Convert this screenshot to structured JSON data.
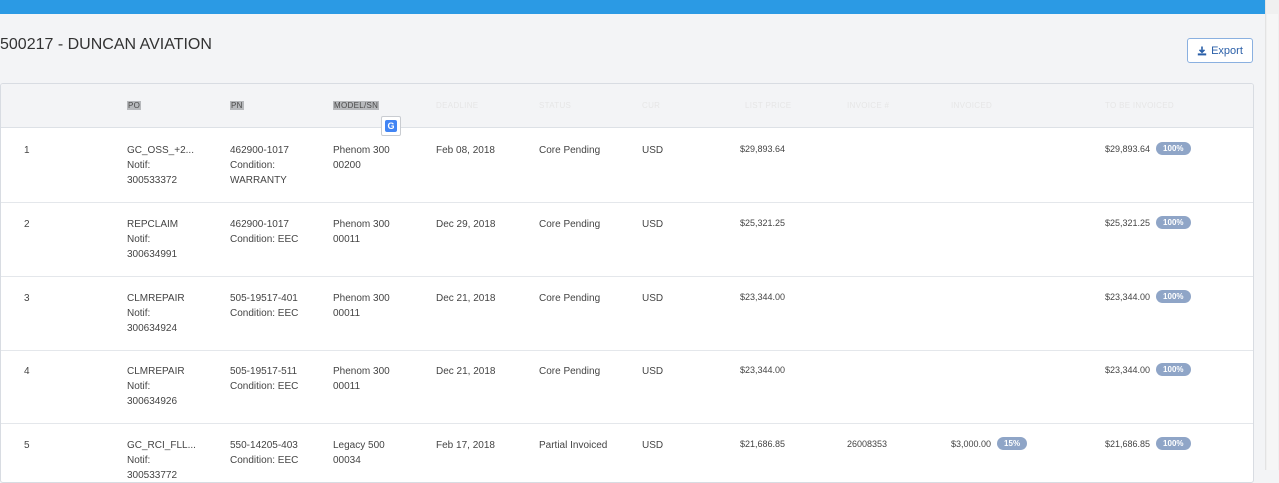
{
  "header": {
    "title": "500217 - DUNCAN AVIATION",
    "export_label": "Export"
  },
  "table": {
    "columns": [
      "PO",
      "PN",
      "MODEL/SN",
      "DEADLINE",
      "STATUS",
      "CUR",
      "LIST PRICE",
      "INVOICE #",
      "INVOICED",
      "TO BE INVOICED"
    ],
    "rows": [
      {
        "num": "1",
        "po": "GC_OSS_+2...",
        "notif_label": "Notif:",
        "notif": "300533372",
        "pn": "462900-1017",
        "condition_label": "Condition:",
        "condition": "WARRANTY",
        "model": "Phenom 300",
        "sn": "00200",
        "deadline": "Feb 08, 2018",
        "status": "Core Pending",
        "cur": "USD",
        "list_price": "$29,893.64",
        "invoice_no": "",
        "invoiced": "",
        "invoiced_pct": "",
        "to_be_invoiced": "$29,893.64",
        "to_be_pct": "100%"
      },
      {
        "num": "2",
        "po": "REPCLAIM",
        "notif_label": "Notif:",
        "notif": "300634991",
        "pn": "462900-1017",
        "condition_label": "Condition: EEC",
        "condition": "",
        "model": "Phenom 300",
        "sn": "00011",
        "deadline": "Dec 29, 2018",
        "status": "Core Pending",
        "cur": "USD",
        "list_price": "$25,321.25",
        "invoice_no": "",
        "invoiced": "",
        "invoiced_pct": "",
        "to_be_invoiced": "$25,321.25",
        "to_be_pct": "100%"
      },
      {
        "num": "3",
        "po": "CLMREPAIR",
        "notif_label": "Notif:",
        "notif": "300634924",
        "pn": "505-19517-401",
        "condition_label": "Condition: EEC",
        "condition": "",
        "model": "Phenom 300",
        "sn": "00011",
        "deadline": "Dec 21, 2018",
        "status": "Core Pending",
        "cur": "USD",
        "list_price": "$23,344.00",
        "invoice_no": "",
        "invoiced": "",
        "invoiced_pct": "",
        "to_be_invoiced": "$23,344.00",
        "to_be_pct": "100%"
      },
      {
        "num": "4",
        "po": "CLMREPAIR",
        "notif_label": "Notif:",
        "notif": "300634926",
        "pn": "505-19517-511",
        "condition_label": "Condition: EEC",
        "condition": "",
        "model": "Phenom 300",
        "sn": "00011",
        "deadline": "Dec 21, 2018",
        "status": "Core Pending",
        "cur": "USD",
        "list_price": "$23,344.00",
        "invoice_no": "",
        "invoiced": "",
        "invoiced_pct": "",
        "to_be_invoiced": "$23,344.00",
        "to_be_pct": "100%"
      },
      {
        "num": "5",
        "po": "GC_RCI_FLL...",
        "notif_label": "Notif:",
        "notif": "300533772",
        "pn": "550-14205-403",
        "condition_label": "Condition: EEC",
        "condition": "",
        "model": "Legacy 500",
        "sn": "00034",
        "deadline": "Feb 17, 2018",
        "status": "Partial Invoiced",
        "cur": "USD",
        "list_price": "$21,686.85",
        "invoice_no": "26008353",
        "invoiced": "$3,000.00",
        "invoiced_pct": "15%",
        "to_be_invoiced": "$21,686.85",
        "to_be_pct": "100%"
      }
    ]
  },
  "icons": {
    "export": "download-icon",
    "translate": "google-translate-icon"
  },
  "colors": {
    "topbar": "#2b9ae4",
    "badge": "#8fa5c7",
    "export_text": "#2a5fa8"
  }
}
